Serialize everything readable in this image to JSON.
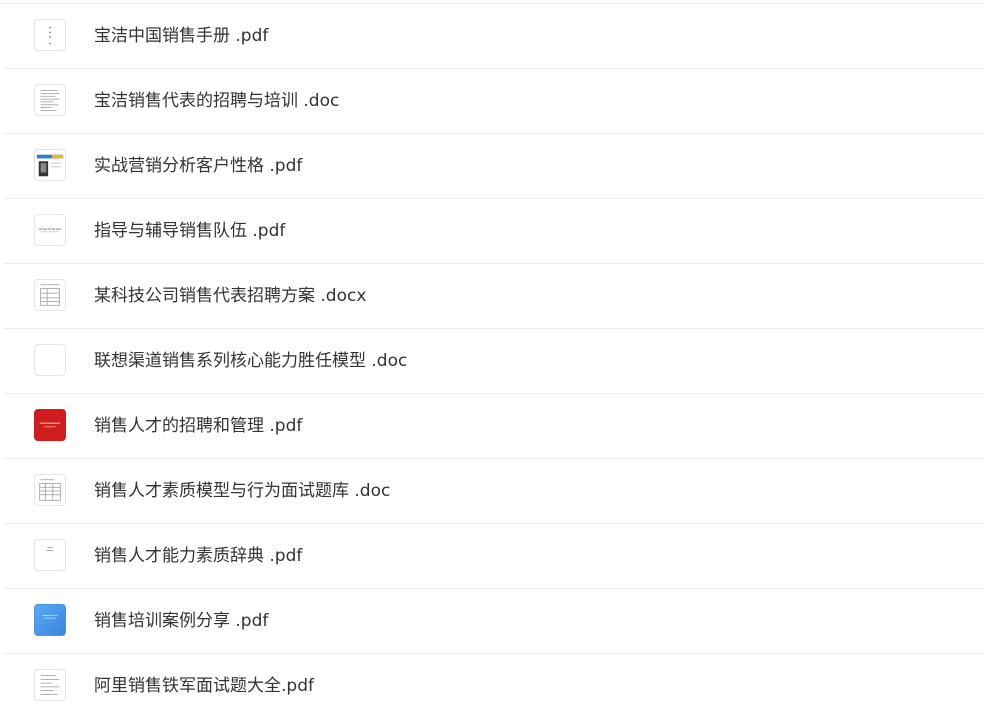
{
  "files": [
    {
      "name": "宝洁中国销售手册 .pdf",
      "thumb": "pdf-thumbnail"
    },
    {
      "name": "宝洁销售代表的招聘与培训 .doc",
      "thumb": "doc-thumbnail"
    },
    {
      "name": "实战营销分析客户性格 .pdf",
      "thumb": "pdf-thumbnail"
    },
    {
      "name": "指导与辅导销售队伍 .pdf",
      "thumb": "pdf-thumbnail"
    },
    {
      "name": "某科技公司销售代表招聘方案 .docx",
      "thumb": "docx-thumbnail"
    },
    {
      "name": "联想渠道销售系列核心能力胜任模型 .doc",
      "thumb": "doc-thumbnail"
    },
    {
      "name": "销售人才的招聘和管理 .pdf",
      "thumb": "pdf-thumbnail"
    },
    {
      "name": "销售人才素质模型与行为面试题库 .doc",
      "thumb": "doc-thumbnail"
    },
    {
      "name": "销售人才能力素质辞典 .pdf",
      "thumb": "pdf-thumbnail"
    },
    {
      "name": "销售培训案例分享 .pdf",
      "thumb": "pdf-thumbnail"
    },
    {
      "name": "阿里销售铁军面试题大全.pdf",
      "thumb": "pdf-thumbnail"
    }
  ],
  "colors": {
    "text": "#333333",
    "divider": "#ececec",
    "red_thumb": "#cf1d1d",
    "blue_thumb": "#4a93e6"
  }
}
